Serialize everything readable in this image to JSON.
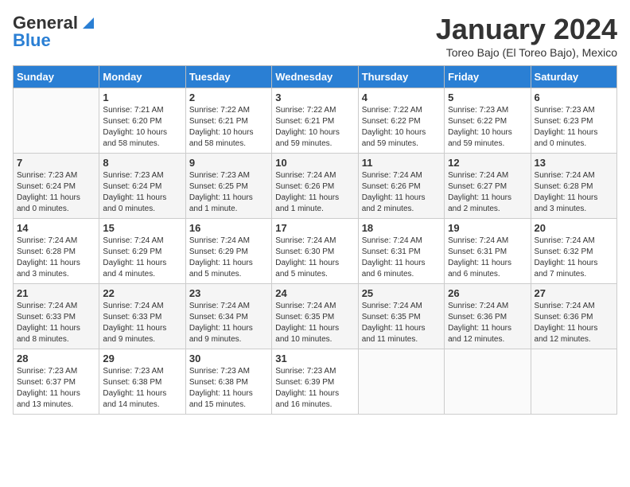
{
  "logo": {
    "line1": "General",
    "line2": "Blue"
  },
  "header": {
    "month": "January 2024",
    "location": "Toreo Bajo (El Toreo Bajo), Mexico"
  },
  "weekdays": [
    "Sunday",
    "Monday",
    "Tuesday",
    "Wednesday",
    "Thursday",
    "Friday",
    "Saturday"
  ],
  "weeks": [
    [
      {
        "day": "",
        "info": ""
      },
      {
        "day": "1",
        "info": "Sunrise: 7:21 AM\nSunset: 6:20 PM\nDaylight: 10 hours\nand 58 minutes."
      },
      {
        "day": "2",
        "info": "Sunrise: 7:22 AM\nSunset: 6:21 PM\nDaylight: 10 hours\nand 58 minutes."
      },
      {
        "day": "3",
        "info": "Sunrise: 7:22 AM\nSunset: 6:21 PM\nDaylight: 10 hours\nand 59 minutes."
      },
      {
        "day": "4",
        "info": "Sunrise: 7:22 AM\nSunset: 6:22 PM\nDaylight: 10 hours\nand 59 minutes."
      },
      {
        "day": "5",
        "info": "Sunrise: 7:23 AM\nSunset: 6:22 PM\nDaylight: 10 hours\nand 59 minutes."
      },
      {
        "day": "6",
        "info": "Sunrise: 7:23 AM\nSunset: 6:23 PM\nDaylight: 11 hours\nand 0 minutes."
      }
    ],
    [
      {
        "day": "7",
        "info": "Sunrise: 7:23 AM\nSunset: 6:24 PM\nDaylight: 11 hours\nand 0 minutes."
      },
      {
        "day": "8",
        "info": "Sunrise: 7:23 AM\nSunset: 6:24 PM\nDaylight: 11 hours\nand 0 minutes."
      },
      {
        "day": "9",
        "info": "Sunrise: 7:23 AM\nSunset: 6:25 PM\nDaylight: 11 hours\nand 1 minute."
      },
      {
        "day": "10",
        "info": "Sunrise: 7:24 AM\nSunset: 6:26 PM\nDaylight: 11 hours\nand 1 minute."
      },
      {
        "day": "11",
        "info": "Sunrise: 7:24 AM\nSunset: 6:26 PM\nDaylight: 11 hours\nand 2 minutes."
      },
      {
        "day": "12",
        "info": "Sunrise: 7:24 AM\nSunset: 6:27 PM\nDaylight: 11 hours\nand 2 minutes."
      },
      {
        "day": "13",
        "info": "Sunrise: 7:24 AM\nSunset: 6:28 PM\nDaylight: 11 hours\nand 3 minutes."
      }
    ],
    [
      {
        "day": "14",
        "info": "Sunrise: 7:24 AM\nSunset: 6:28 PM\nDaylight: 11 hours\nand 3 minutes."
      },
      {
        "day": "15",
        "info": "Sunrise: 7:24 AM\nSunset: 6:29 PM\nDaylight: 11 hours\nand 4 minutes."
      },
      {
        "day": "16",
        "info": "Sunrise: 7:24 AM\nSunset: 6:29 PM\nDaylight: 11 hours\nand 5 minutes."
      },
      {
        "day": "17",
        "info": "Sunrise: 7:24 AM\nSunset: 6:30 PM\nDaylight: 11 hours\nand 5 minutes."
      },
      {
        "day": "18",
        "info": "Sunrise: 7:24 AM\nSunset: 6:31 PM\nDaylight: 11 hours\nand 6 minutes."
      },
      {
        "day": "19",
        "info": "Sunrise: 7:24 AM\nSunset: 6:31 PM\nDaylight: 11 hours\nand 6 minutes."
      },
      {
        "day": "20",
        "info": "Sunrise: 7:24 AM\nSunset: 6:32 PM\nDaylight: 11 hours\nand 7 minutes."
      }
    ],
    [
      {
        "day": "21",
        "info": "Sunrise: 7:24 AM\nSunset: 6:33 PM\nDaylight: 11 hours\nand 8 minutes."
      },
      {
        "day": "22",
        "info": "Sunrise: 7:24 AM\nSunset: 6:33 PM\nDaylight: 11 hours\nand 9 minutes."
      },
      {
        "day": "23",
        "info": "Sunrise: 7:24 AM\nSunset: 6:34 PM\nDaylight: 11 hours\nand 9 minutes."
      },
      {
        "day": "24",
        "info": "Sunrise: 7:24 AM\nSunset: 6:35 PM\nDaylight: 11 hours\nand 10 minutes."
      },
      {
        "day": "25",
        "info": "Sunrise: 7:24 AM\nSunset: 6:35 PM\nDaylight: 11 hours\nand 11 minutes."
      },
      {
        "day": "26",
        "info": "Sunrise: 7:24 AM\nSunset: 6:36 PM\nDaylight: 11 hours\nand 12 minutes."
      },
      {
        "day": "27",
        "info": "Sunrise: 7:24 AM\nSunset: 6:36 PM\nDaylight: 11 hours\nand 12 minutes."
      }
    ],
    [
      {
        "day": "28",
        "info": "Sunrise: 7:23 AM\nSunset: 6:37 PM\nDaylight: 11 hours\nand 13 minutes."
      },
      {
        "day": "29",
        "info": "Sunrise: 7:23 AM\nSunset: 6:38 PM\nDaylight: 11 hours\nand 14 minutes."
      },
      {
        "day": "30",
        "info": "Sunrise: 7:23 AM\nSunset: 6:38 PM\nDaylight: 11 hours\nand 15 minutes."
      },
      {
        "day": "31",
        "info": "Sunrise: 7:23 AM\nSunset: 6:39 PM\nDaylight: 11 hours\nand 16 minutes."
      },
      {
        "day": "",
        "info": ""
      },
      {
        "day": "",
        "info": ""
      },
      {
        "day": "",
        "info": ""
      }
    ]
  ]
}
